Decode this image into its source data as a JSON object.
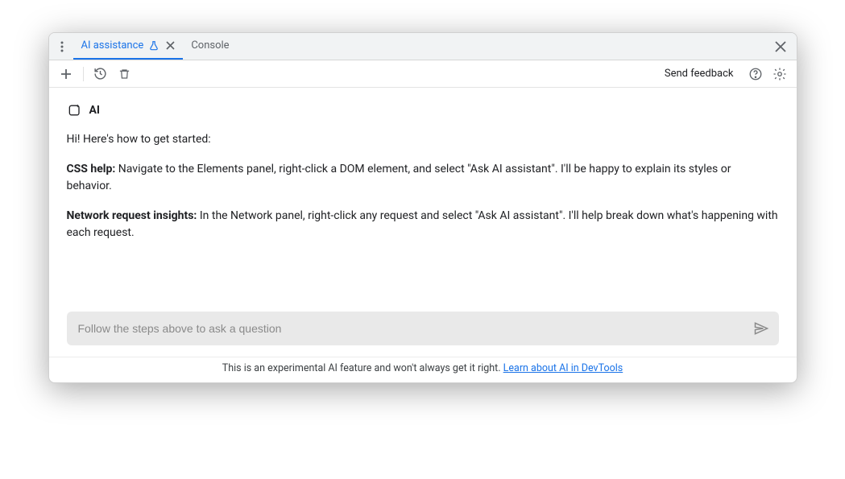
{
  "tabs": {
    "active": {
      "label": "AI assistance"
    },
    "secondary": {
      "label": "Console"
    }
  },
  "toolbar": {
    "feedback_label": "Send feedback"
  },
  "ai": {
    "header_label": "AI",
    "intro": "Hi! Here's how to get started:",
    "css_label": "CSS help:",
    "css_text": " Navigate to the Elements panel, right-click a DOM element, and select \"Ask AI assistant\". I'll be happy to explain its styles or behavior.",
    "net_label": "Network request insights:",
    "net_text": " In the Network panel, right-click any request and select \"Ask AI assistant\". I'll help break down what's happening with each request."
  },
  "input": {
    "placeholder": "Follow the steps above to ask a question"
  },
  "footer": {
    "text": "This is an experimental AI feature and won't always get it right. ",
    "link_label": "Learn about AI in DevTools"
  }
}
